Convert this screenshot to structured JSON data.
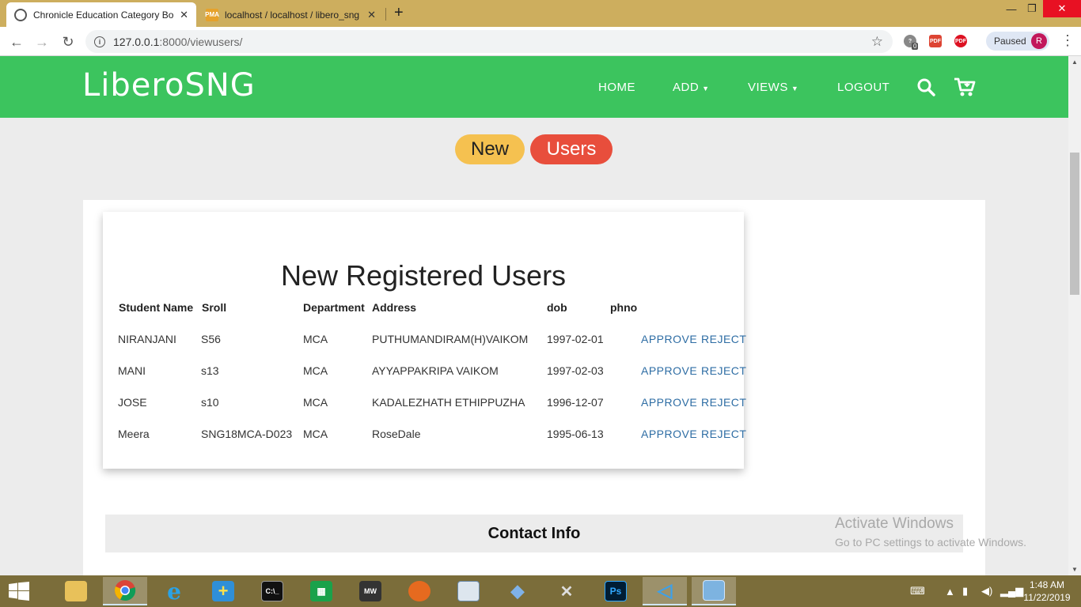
{
  "browser": {
    "tabs": [
      {
        "title": "Chronicle Education Category Bo",
        "active": true,
        "icon": "globe-icon"
      },
      {
        "title": "localhost / localhost / libero_sng",
        "active": false,
        "icon": "phpmyadmin-icon"
      }
    ],
    "url_host": "127.0.0.1",
    "url_rest": ":8000/viewusers/",
    "profile_status": "Paused",
    "profile_initial": "R",
    "ext_badge": "0"
  },
  "site": {
    "brand": "LiberoSNG",
    "nav": {
      "home": "HOME",
      "add": "ADD",
      "views": "VIEWS",
      "logout": "LOGOUT"
    },
    "colors": {
      "header": "#3cc45e",
      "badge_new": "#f5c150",
      "badge_users": "#e84e3c",
      "action_link": "#2e6da4"
    }
  },
  "page": {
    "badge_new": "New",
    "badge_users": "Users",
    "card_title": "New Registered Users",
    "table": {
      "headers": [
        "Student Name",
        "Sroll",
        "Department",
        "Address",
        "dob",
        "phno"
      ],
      "rows": [
        {
          "name": "NIRANJANI",
          "sroll": "S56",
          "department": "MCA",
          "address": "PUTHUMANDIRAM(H)VAIKOM",
          "dob": "1997-02-01",
          "phno": ""
        },
        {
          "name": "MANI",
          "sroll": "s13",
          "department": "MCA",
          "address": "AYYAPPAKRIPA VAIKOM",
          "dob": "1997-02-03",
          "phno": ""
        },
        {
          "name": "JOSE",
          "sroll": "s10",
          "department": "MCA",
          "address": "KADALEZHATH ETHIPPUZHA",
          "dob": "1996-12-07",
          "phno": ""
        },
        {
          "name": "Meera",
          "sroll": "SNG18MCA-D023",
          "department": "MCA",
          "address": "RoseDale",
          "dob": "1995-06-13",
          "phno": ""
        }
      ],
      "approve_label": "APPROVE",
      "reject_label": "REJECT"
    },
    "contact_title": "Contact Info"
  },
  "watermark": {
    "line1": "Activate Windows",
    "line2": "Go to PC settings to activate Windows."
  },
  "taskbar": {
    "time": "1:48 AM",
    "date": "11/22/2019",
    "apps": [
      "file-explorer",
      "chrome",
      "internet-explorer",
      "install-manager",
      "command-prompt",
      "store",
      "nfs-most-wanted",
      "firefox",
      "notepad",
      "dolphin",
      "tools",
      "photoshop",
      "visual-studio-code",
      "remote-desktop"
    ]
  }
}
